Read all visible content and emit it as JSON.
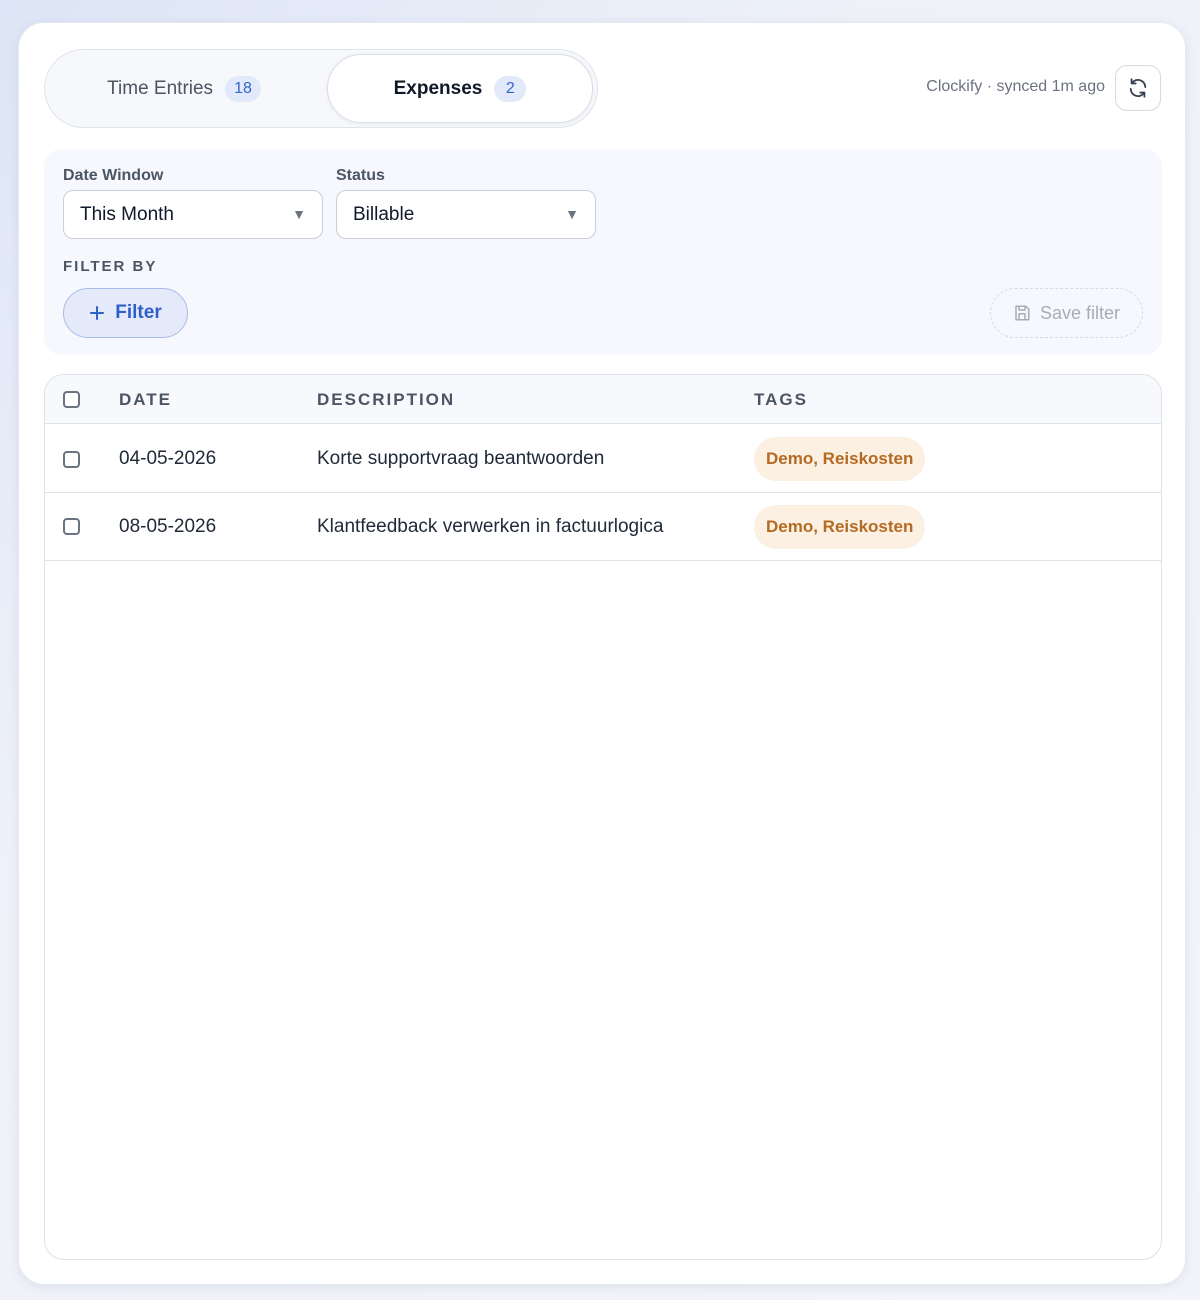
{
  "tabs": [
    {
      "label": "Time Entries",
      "count": "18"
    },
    {
      "label": "Expenses",
      "count": "2"
    }
  ],
  "sync_status": "Clockify · synced 1m ago",
  "filters": {
    "date_window_label": "Date Window",
    "date_window_value": "This Month",
    "status_label": "Status",
    "status_value": "Billable",
    "filter_by_label": "FILTER BY",
    "add_filter_label": "Filter",
    "save_filter_label": "Save filter"
  },
  "table": {
    "headers": [
      "DATE",
      "DESCRIPTION",
      "TAGS"
    ],
    "rows": [
      {
        "date": "04-05-2026",
        "description": "Korte supportvraag beantwoorden",
        "tags": "Demo, Reiskosten"
      },
      {
        "date": "08-05-2026",
        "description": "Klantfeedback verwerken in factuurlogica",
        "tags": "Demo, Reiskosten"
      }
    ]
  },
  "colors": {
    "accent": "#2f5fc9",
    "tag_bg": "#fbf0e2",
    "tag_text": "#b46a23"
  },
  "icons": {
    "refresh": "refresh-icon",
    "add": "plus-icon",
    "save": "floppy-disk-icon",
    "dropdown": "caret-down-icon"
  }
}
